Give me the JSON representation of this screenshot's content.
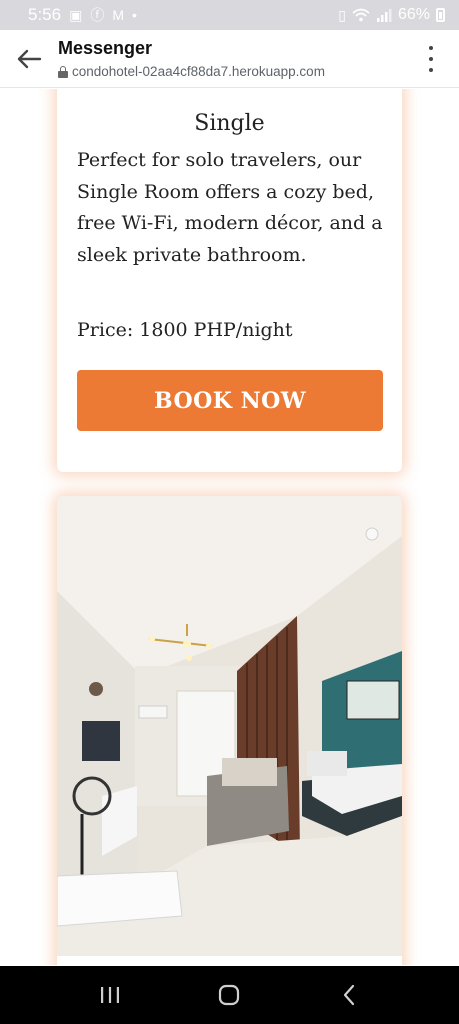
{
  "status_bar": {
    "time": "5:56",
    "battery": "66%",
    "left_icons": [
      "gallery-icon",
      "facebook-icon",
      "gmail-icon",
      "dot-icon"
    ],
    "right_icons": [
      "battery-saver-icon",
      "wifi-icon",
      "signal-icon",
      "battery-icon"
    ]
  },
  "browser": {
    "title": "Messenger",
    "url": "condohotel-02aa4cf88da7.herokuapp.com"
  },
  "rooms": [
    {
      "name": "Single",
      "description": "Perfect for solo travelers, our Single Room offers a cozy bed, free Wi-Fi, modern décor, and a sleek private bathroom.",
      "price": "Price: 1800 PHP/night",
      "button_label": "BOOK NOW"
    }
  ],
  "colors": {
    "accent": "#ec7a34",
    "card_glow": "#f08c50",
    "status_bar": "#d9d9dd",
    "nav_bar": "#000000"
  }
}
